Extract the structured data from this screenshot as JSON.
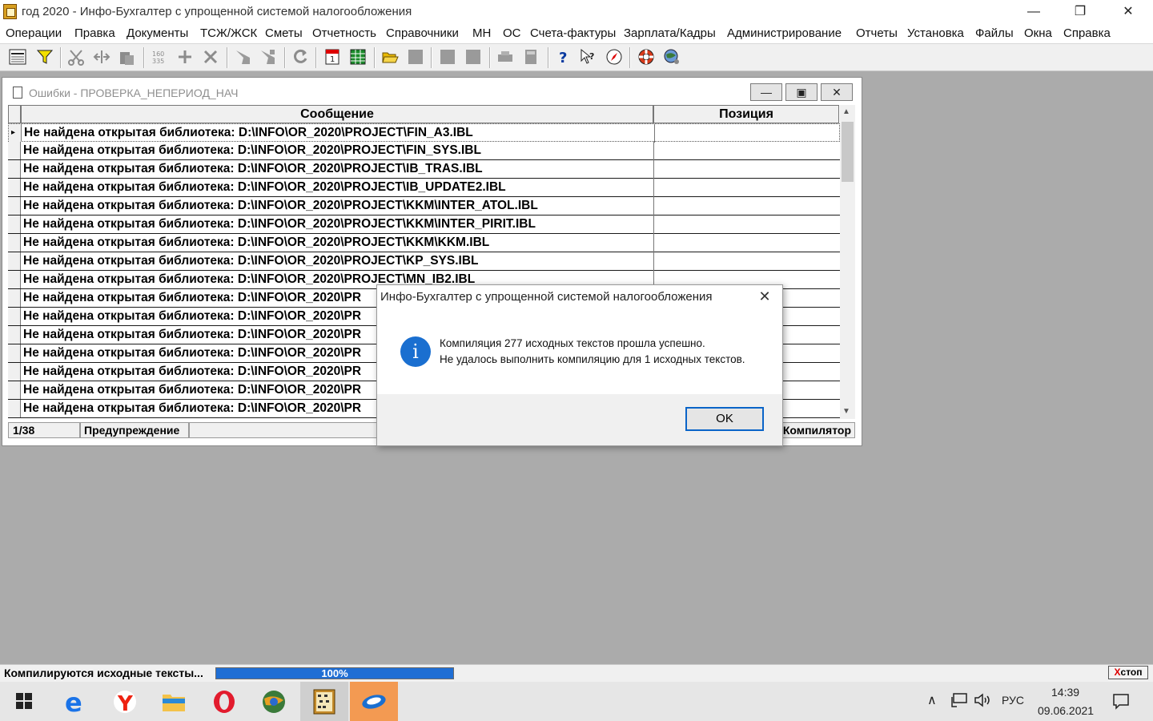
{
  "window": {
    "title": "год 2020 - Инфо-Бухгалтер с упрощенной системой налогообложения"
  },
  "menu": [
    "Операции",
    "Правка",
    "Документы",
    "ТСЖ/ЖСК",
    "Сметы",
    "Отчетность",
    "Справочники",
    "МН",
    "ОС",
    "Счета-фактуры",
    "Зарплата/Кадры",
    "Администрирование",
    "Отчеты",
    "Установка",
    "Файлы",
    "Окна",
    "Справка"
  ],
  "errors_window": {
    "title": "Ошибки - ПРОВЕРКА_НЕПЕРИОД_НАЧ",
    "columns": [
      "Сообщение",
      "Позиция"
    ],
    "rows": [
      "Не найдена открытая библиотека: D:\\INFO\\OR_2020\\PROJECT\\FIN_A3.IBL",
      "Не найдена открытая библиотека: D:\\INFO\\OR_2020\\PROJECT\\FIN_SYS.IBL",
      "Не найдена открытая библиотека: D:\\INFO\\OR_2020\\PROJECT\\IB_TRAS.IBL",
      "Не найдена открытая библиотека: D:\\INFO\\OR_2020\\PROJECT\\IB_UPDATE2.IBL",
      "Не найдена открытая библиотека: D:\\INFO\\OR_2020\\PROJECT\\KKM\\INTER_ATOL.IBL",
      "Не найдена открытая библиотека: D:\\INFO\\OR_2020\\PROJECT\\KKM\\INTER_PIRIT.IBL",
      "Не найдена открытая библиотека: D:\\INFO\\OR_2020\\PROJECT\\KKM\\KKM.IBL",
      "Не найдена открытая библиотека: D:\\INFO\\OR_2020\\PROJECT\\KP_SYS.IBL",
      "Не найдена открытая библиотека: D:\\INFO\\OR_2020\\PROJECT\\MN_IB2.IBL",
      "Не найдена открытая библиотека: D:\\INFO\\OR_2020\\PR",
      "Не найдена открытая библиотека: D:\\INFO\\OR_2020\\PR",
      "Не найдена открытая библиотека: D:\\INFO\\OR_2020\\PR",
      "Не найдена открытая библиотека: D:\\INFO\\OR_2020\\PR",
      "Не найдена открытая библиотека: D:\\INFO\\OR_2020\\PR",
      "Не найдена открытая библиотека: D:\\INFO\\OR_2020\\PR",
      "Не найдена открытая библиотека: D:\\INFO\\OR_2020\\PR"
    ],
    "status_position": "1/38",
    "status_type": "Предупреждение",
    "status_source": "Компилятор"
  },
  "dialog": {
    "title": "Инфо-Бухгалтер с упрощенной системой налогообложения",
    "line1": "Компиляция 277 исходных текстов прошла успешно.",
    "line2": "Не удалось выполнить компиляцию для 1 исходных текстов.",
    "ok_label": "OK",
    "icon": "info-icon"
  },
  "app_status": {
    "text": "Компилируются исходные тексты...",
    "progress": 100,
    "progress_label": "100%",
    "stop_label": "стоп",
    "stop_mark": "X"
  },
  "taskbar": {
    "language": "РУС",
    "time": "14:39",
    "date": "09.06.2021",
    "apps": [
      "start-icon",
      "edge-icon",
      "yandex-icon",
      "explorer-icon",
      "opera-icon",
      "browser-icon",
      "abacus-icon",
      "infobuh-icon"
    ]
  },
  "colors": {
    "accent": "#1f6ed4",
    "workspace": "#ababab",
    "info": "#1a6fd0"
  }
}
